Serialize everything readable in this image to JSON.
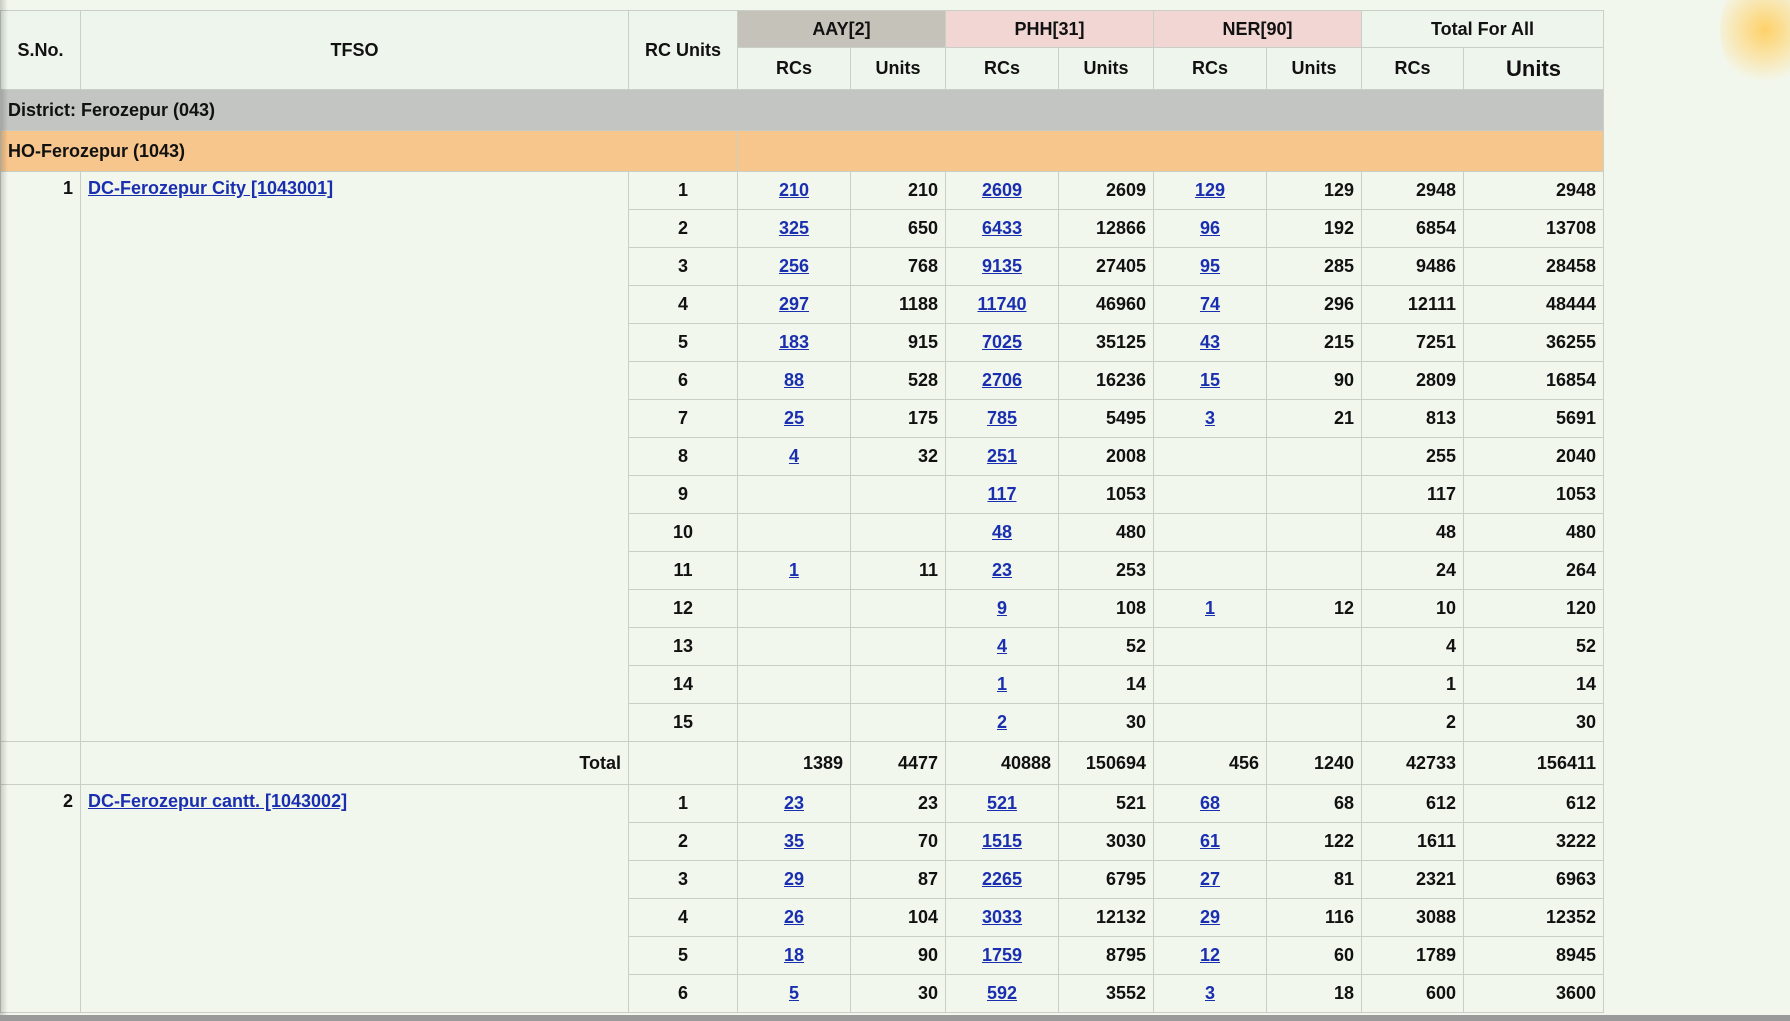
{
  "header": {
    "sno": "S.No.",
    "tfso": "TFSO",
    "rc_units": "RC Units",
    "groups": [
      "AAY[2]",
      "PHH[31]",
      "NER[90]",
      "Total For All"
    ],
    "sub": {
      "rcs": "RCs",
      "units": "Units"
    }
  },
  "district": "District: Ferozepur (043)",
  "ho": "HO-Ferozepur (1043)",
  "total_label": "Total",
  "offices": [
    {
      "sno": "1",
      "name": "DC-Ferozepur City [1043001]",
      "rows": [
        {
          "u": "1",
          "a": "210",
          "au": "210",
          "p": "2609",
          "pu": "2609",
          "n": "129",
          "nu": "129",
          "t": "2948",
          "tu": "2948"
        },
        {
          "u": "2",
          "a": "325",
          "au": "650",
          "p": "6433",
          "pu": "12866",
          "n": "96",
          "nu": "192",
          "t": "6854",
          "tu": "13708"
        },
        {
          "u": "3",
          "a": "256",
          "au": "768",
          "p": "9135",
          "pu": "27405",
          "n": "95",
          "nu": "285",
          "t": "9486",
          "tu": "28458"
        },
        {
          "u": "4",
          "a": "297",
          "au": "1188",
          "p": "11740",
          "pu": "46960",
          "n": "74",
          "nu": "296",
          "t": "12111",
          "tu": "48444"
        },
        {
          "u": "5",
          "a": "183",
          "au": "915",
          "p": "7025",
          "pu": "35125",
          "n": "43",
          "nu": "215",
          "t": "7251",
          "tu": "36255"
        },
        {
          "u": "6",
          "a": "88",
          "au": "528",
          "p": "2706",
          "pu": "16236",
          "n": "15",
          "nu": "90",
          "t": "2809",
          "tu": "16854"
        },
        {
          "u": "7",
          "a": "25",
          "au": "175",
          "p": "785",
          "pu": "5495",
          "n": "3",
          "nu": "21",
          "t": "813",
          "tu": "5691"
        },
        {
          "u": "8",
          "a": "4",
          "au": "32",
          "p": "251",
          "pu": "2008",
          "n": "",
          "nu": "",
          "t": "255",
          "tu": "2040"
        },
        {
          "u": "9",
          "a": "",
          "au": "",
          "p": "117",
          "pu": "1053",
          "n": "",
          "nu": "",
          "t": "117",
          "tu": "1053"
        },
        {
          "u": "10",
          "a": "",
          "au": "",
          "p": "48",
          "pu": "480",
          "n": "",
          "nu": "",
          "t": "48",
          "tu": "480"
        },
        {
          "u": "11",
          "a": "1",
          "au": "11",
          "p": "23",
          "pu": "253",
          "n": "",
          "nu": "",
          "t": "24",
          "tu": "264"
        },
        {
          "u": "12",
          "a": "",
          "au": "",
          "p": "9",
          "pu": "108",
          "n": "1",
          "nu": "12",
          "t": "10",
          "tu": "120"
        },
        {
          "u": "13",
          "a": "",
          "au": "",
          "p": "4",
          "pu": "52",
          "n": "",
          "nu": "",
          "t": "4",
          "tu": "52"
        },
        {
          "u": "14",
          "a": "",
          "au": "",
          "p": "1",
          "pu": "14",
          "n": "",
          "nu": "",
          "t": "1",
          "tu": "14"
        },
        {
          "u": "15",
          "a": "",
          "au": "",
          "p": "2",
          "pu": "30",
          "n": "",
          "nu": "",
          "t": "2",
          "tu": "30"
        }
      ],
      "total": {
        "a": "1389",
        "au": "4477",
        "p": "40888",
        "pu": "150694",
        "n": "456",
        "nu": "1240",
        "t": "42733",
        "tu": "156411"
      }
    },
    {
      "sno": "2",
      "name": "DC-Ferozepur cantt. [1043002]",
      "rows": [
        {
          "u": "1",
          "a": "23",
          "au": "23",
          "p": "521",
          "pu": "521",
          "n": "68",
          "nu": "68",
          "t": "612",
          "tu": "612"
        },
        {
          "u": "2",
          "a": "35",
          "au": "70",
          "p": "1515",
          "pu": "3030",
          "n": "61",
          "nu": "122",
          "t": "1611",
          "tu": "3222"
        },
        {
          "u": "3",
          "a": "29",
          "au": "87",
          "p": "2265",
          "pu": "6795",
          "n": "27",
          "nu": "81",
          "t": "2321",
          "tu": "6963"
        },
        {
          "u": "4",
          "a": "26",
          "au": "104",
          "p": "3033",
          "pu": "12132",
          "n": "29",
          "nu": "116",
          "t": "3088",
          "tu": "12352"
        },
        {
          "u": "5",
          "a": "18",
          "au": "90",
          "p": "1759",
          "pu": "8795",
          "n": "12",
          "nu": "60",
          "t": "1789",
          "tu": "8945"
        },
        {
          "u": "6",
          "a": "5",
          "au": "30",
          "p": "592",
          "pu": "3552",
          "n": "3",
          "nu": "18",
          "t": "600",
          "tu": "3600"
        }
      ],
      "total": null
    }
  ]
}
